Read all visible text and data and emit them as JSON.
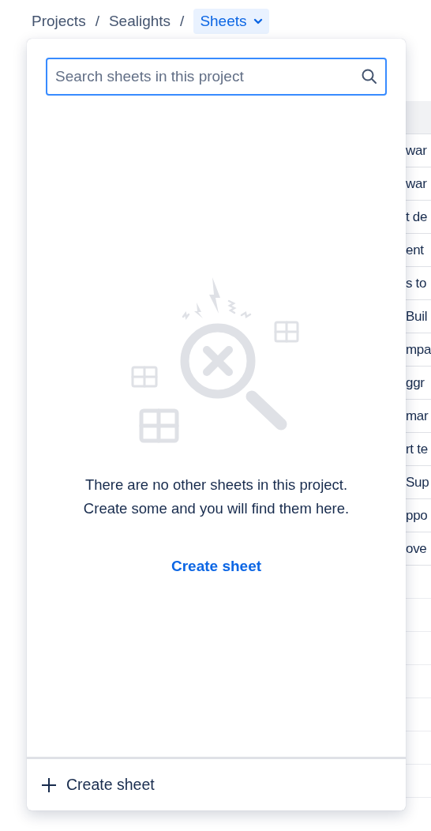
{
  "breadcrumb_separators": [
    "/",
    "/"
  ],
  "breadcrumbs": [
    {
      "label": "Projects",
      "selected": false
    },
    {
      "label": "Sealights",
      "selected": false
    },
    {
      "label": "Sheets",
      "selected": true
    }
  ],
  "background_table": {
    "rows": [
      "war",
      "war",
      "t de",
      "ent",
      "s to",
      "Buil",
      "mpa",
      "ggr",
      "mar",
      "rt te",
      "Sup",
      "ppo",
      "ove"
    ]
  },
  "popover": {
    "search": {
      "placeholder": "Search sheets in this project"
    },
    "empty_message": [
      "There are no other sheets in this project.",
      "Create some and you will find them here."
    ],
    "create_link": "Create sheet",
    "footer_action": "Create sheet"
  }
}
